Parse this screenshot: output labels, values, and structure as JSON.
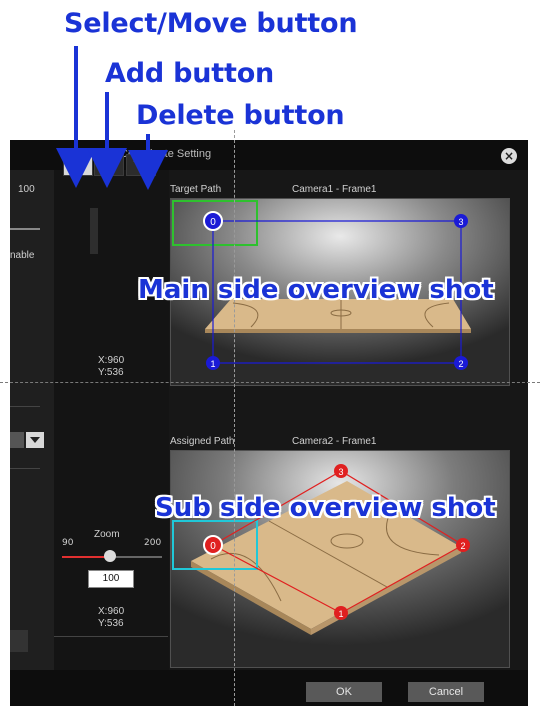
{
  "callouts": {
    "select_move": "Select/Move button",
    "add": "Add button",
    "delete": "Delete button"
  },
  "dialog": {
    "title": "Coordinate Setting",
    "close_icon": "close-icon"
  },
  "left_panel": {
    "value": "100",
    "text_fragment": "nable"
  },
  "toolbar": {
    "tools": [
      {
        "name": "select-move",
        "icon": "hand-pointer-icon",
        "active": true
      },
      {
        "name": "add",
        "icon": "add-point-icon",
        "active": false
      },
      {
        "name": "delete",
        "icon": "delete-point-icon",
        "active": false
      }
    ]
  },
  "main_view": {
    "path_label": "Target Path",
    "camera_label": "Camera1 - Frame1",
    "coord_x": "X:960",
    "coord_y": "Y:536",
    "overlay": "Main side overview shot",
    "points": [
      "0",
      "1",
      "2",
      "3"
    ],
    "point_color": "#1a1ad6",
    "selection_color": "#2ec12e"
  },
  "sub_view": {
    "path_label": "Assigned Path",
    "camera_label": "Camera2 - Frame1",
    "coord_x": "X:960",
    "coord_y": "Y:536",
    "overlay": "Sub side overview shot",
    "points": [
      "0",
      "1",
      "2",
      "3"
    ],
    "point_color": "#e02020",
    "selection_color": "#20c8d8"
  },
  "zoom": {
    "label": "Zoom",
    "min": "90",
    "max": "200",
    "value": "100"
  },
  "footer": {
    "ok": "OK",
    "cancel": "Cancel"
  }
}
